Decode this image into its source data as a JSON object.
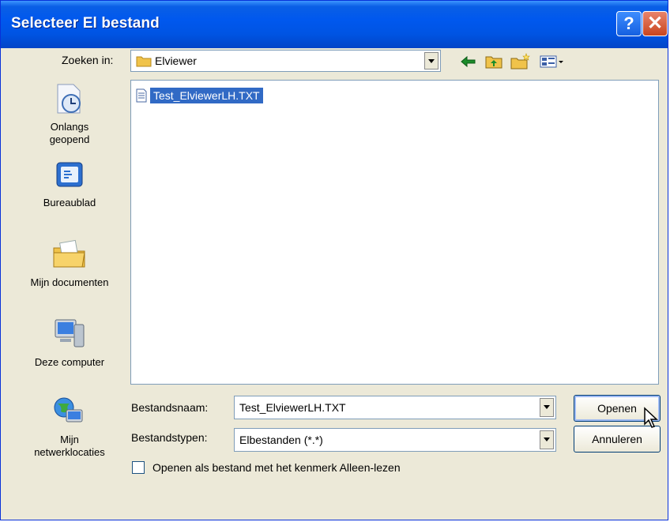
{
  "window": {
    "title": "Selecteer El bestand"
  },
  "toolbar": {
    "look_in_label": "Zoeken in:",
    "look_in_value": "Elviewer"
  },
  "places": [
    {
      "label_line1": "Onlangs",
      "label_line2": "geopend"
    },
    {
      "label_line1": "Bureaublad",
      "label_line2": ""
    },
    {
      "label_line1": "Mijn documenten",
      "label_line2": ""
    },
    {
      "label_line1": "Deze computer",
      "label_line2": ""
    },
    {
      "label_line1": "Mijn",
      "label_line2": "netwerklocaties"
    }
  ],
  "files": [
    {
      "name": "Test_ElviewerLH.TXT",
      "selected": true
    }
  ],
  "form": {
    "filename_label": "Bestandsnaam:",
    "filename_value": "Test_ElviewerLH.TXT",
    "filetype_label": "Bestandstypen:",
    "filetype_value": "Elbestanden (*.*)",
    "readonly_label": "Openen als bestand met het kenmerk Alleen-lezen",
    "readonly_checked": false
  },
  "buttons": {
    "open": "Openen",
    "cancel": "Annuleren"
  },
  "colors": {
    "titlebar": "#0054e3",
    "selection": "#316ac5",
    "dialog_bg": "#ece9d8"
  }
}
